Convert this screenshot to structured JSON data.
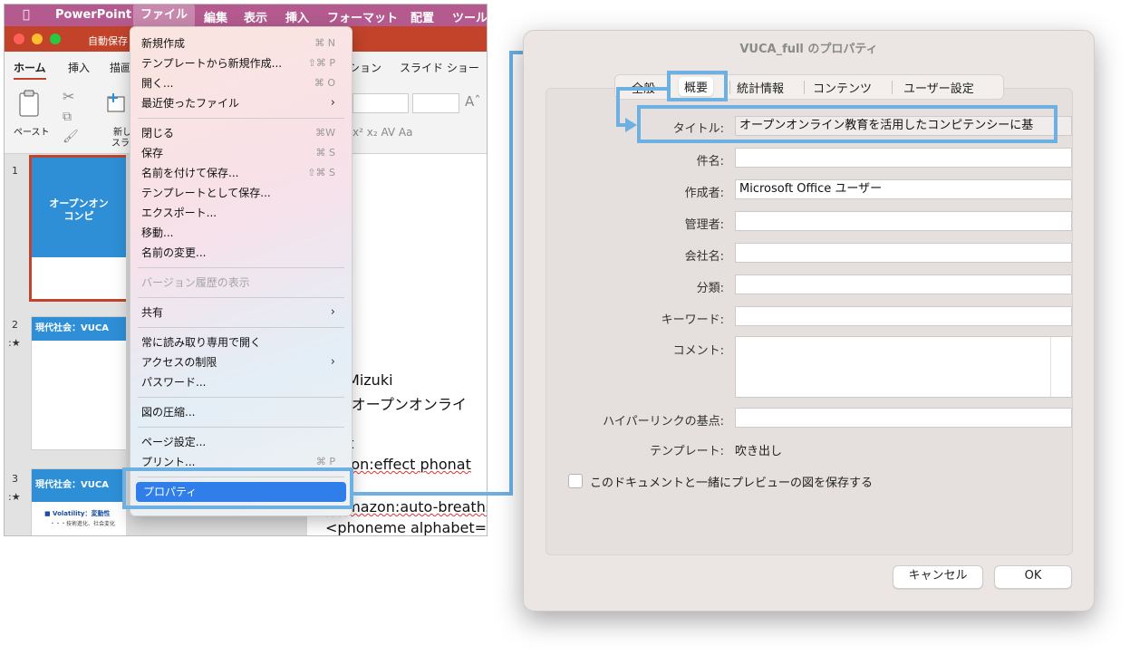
{
  "mac_menubar": {
    "app": "PowerPoint",
    "items": [
      "ファイル",
      "編集",
      "表示",
      "挿入",
      "フォーマット",
      "配置",
      "ツール"
    ]
  },
  "window": {
    "autosave": "自動保存"
  },
  "ribbon": {
    "tabs": [
      "ホーム",
      "挿入",
      "描画",
      "ション",
      "スライド ショー"
    ],
    "paste_label": "ペースト",
    "new_slide_label_1": "新し",
    "new_slide_label_2": "スラ"
  },
  "file_menu": {
    "items": [
      {
        "label": "新規作成",
        "shortcut": "⌘ N"
      },
      {
        "label": "テンプレートから新規作成...",
        "shortcut": "⇧⌘ P"
      },
      {
        "label": "開く...",
        "shortcut": "⌘ O"
      },
      {
        "label": "最近使ったファイル",
        "shortcut": "›"
      },
      {
        "label": "閉じる",
        "shortcut": "⌘W"
      },
      {
        "label": "保存",
        "shortcut": "⌘ S"
      },
      {
        "label": "名前を付けて保存...",
        "shortcut": "⇧⌘ S"
      },
      {
        "label": "テンプレートとして保存..."
      },
      {
        "label": "エクスポート..."
      },
      {
        "label": "移動..."
      },
      {
        "label": "名前の変更..."
      },
      {
        "label": "バージョン履歴の表示"
      },
      {
        "label": "共有",
        "shortcut": "›"
      },
      {
        "label": "常に読み取り専用で開く"
      },
      {
        "label": "アクセスの制限",
        "shortcut": "›"
      },
      {
        "label": "パスワード..."
      },
      {
        "label": "図の圧縮..."
      },
      {
        "label": "ページ設定..."
      },
      {
        "label": "プリント...",
        "shortcut": "⌘ P"
      },
      {
        "label": "プロパティ"
      }
    ]
  },
  "slides": [
    {
      "num": "1",
      "title_1": "オープンオン",
      "title_2": "コンピ"
    },
    {
      "num": "2",
      "title": "現代社会：VUCA"
    },
    {
      "num": "3",
      "title": "現代社会：VUCA",
      "bullet": "■ Volatility：変動性",
      "sub": "・・・技術進化、社会変化"
    }
  ],
  "editor_lines": [
    "ce:Mizuki",
    "pic:オープンオンライ",
    "text",
    "nazon:effect phonat",
    "<amazon:auto-breaths",
    "<phoneme alphabet=\"x"
  ],
  "dialog": {
    "title": "VUCA_full のプロパティ",
    "tabs": [
      "全般",
      "概要",
      "統計情報",
      "コンテンツ",
      "ユーザー設定"
    ],
    "active_tab": "概要",
    "fields": [
      {
        "label": "タイトル:",
        "value": "オープンオンライン教育を活用したコンピテンシーに基"
      },
      {
        "label": "件名:",
        "value": ""
      },
      {
        "label": "作成者:",
        "value": "Microsoft Office ユーザー"
      },
      {
        "label": "管理者:",
        "value": ""
      },
      {
        "label": "会社名:",
        "value": ""
      },
      {
        "label": "分類:",
        "value": ""
      },
      {
        "label": "キーワード:",
        "value": ""
      },
      {
        "label": "コメント:",
        "value": ""
      },
      {
        "label": "ハイパーリンクの基点:",
        "value": ""
      }
    ],
    "template_label": "テンプレート:",
    "template_value": "吹き出し",
    "checkbox_label": "このドキュメントと一緒にプレビューの図を保存する",
    "cancel_label": "キャンセル",
    "ok_label": "OK"
  },
  "colors": {
    "accent_callout": "#6db1e2",
    "menu_selection": "#2f7ee9",
    "powerpoint_red": "#c2432a",
    "slide_blue": "#2e8fd6"
  }
}
